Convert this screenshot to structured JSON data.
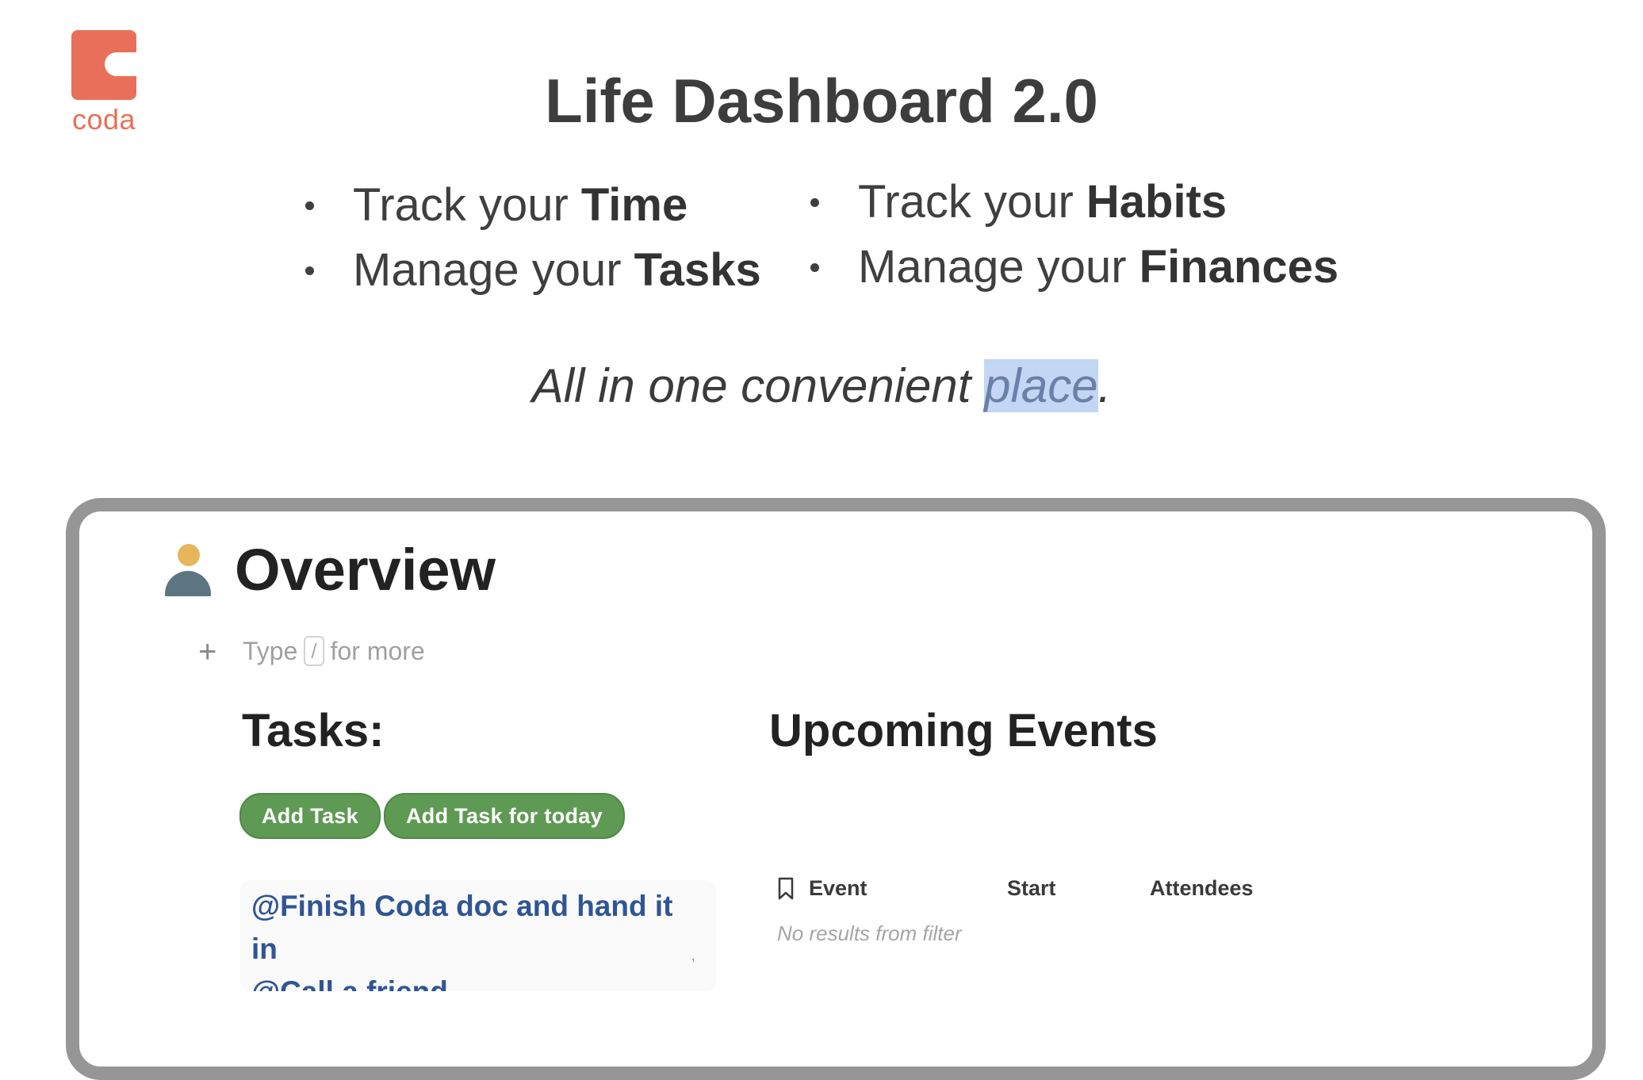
{
  "logo": {
    "text": "coda",
    "color": "#ea6f5a"
  },
  "title": "Life Dashboard 2.0",
  "features": {
    "left": [
      {
        "prefix": "Track your ",
        "bold": "Time"
      },
      {
        "prefix": "Manage your ",
        "bold": "Tasks"
      }
    ],
    "right": [
      {
        "prefix": "Track your ",
        "bold": "Habits"
      },
      {
        "prefix": "Manage your ",
        "bold": "Finances"
      }
    ]
  },
  "tagline": {
    "before": "All in one convenient ",
    "highlighted": "place",
    "after": "."
  },
  "overview": {
    "title": "Overview",
    "icon": "person-icon",
    "type_hint": {
      "prefix": "Type",
      "key": "/",
      "suffix": "for more"
    }
  },
  "tasks": {
    "heading": "Tasks:",
    "buttons": {
      "add_task": "Add Task",
      "add_task_today": "Add Task for today"
    },
    "items": [
      "@Finish Coda doc and hand it in",
      "@Call a friend"
    ],
    "button_color": "#5f9a54",
    "link_color": "#2f5594"
  },
  "events": {
    "heading": "Upcoming Events",
    "columns": [
      "Event",
      "Start",
      "Attendees"
    ],
    "empty_text": "No results from filter"
  }
}
